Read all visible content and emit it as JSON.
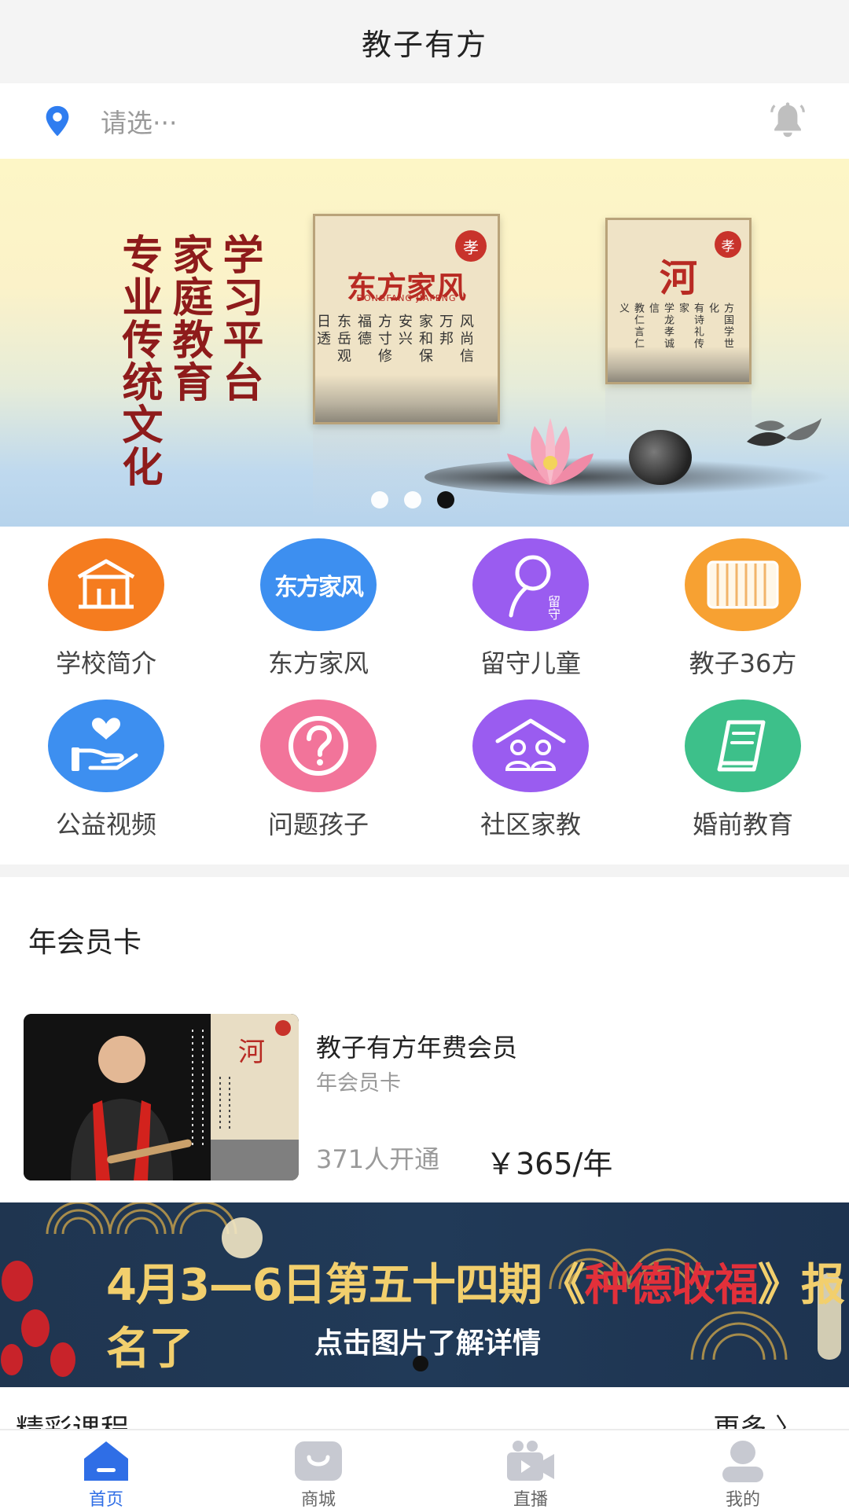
{
  "header": {
    "title": "教子有方"
  },
  "location": {
    "placeholder": "请选···"
  },
  "hero": {
    "slogan": [
      "学习平台",
      "家庭教育",
      "专业传统文化"
    ],
    "card1": {
      "badge": "孝",
      "title": "东方家风",
      "sub": "DONGFANG JIAFENG",
      "poem": [
        "风尚信万邦",
        "家和保安兴",
        "方寸修福德",
        "东岳观日透"
      ]
    },
    "card2": {
      "badge": "孝",
      "title": "河",
      "poem": [
        "方国学世化",
        "有诗礼传家",
        "学龙孝诚信",
        "教仁言仁义"
      ]
    },
    "slide_count": 3,
    "active_slide": 3
  },
  "grid": {
    "items": [
      {
        "label": "学校简介",
        "icon": "school-icon",
        "color": "#f57c1f"
      },
      {
        "label": "东方家风",
        "icon": "dongfang-logo-icon",
        "color": "#3d8ff0",
        "logo_text": "东方家风"
      },
      {
        "label": "留守儿童",
        "icon": "left-behind-child-icon",
        "color": "#9a5cf0",
        "small_text": "留守"
      },
      {
        "label": "教子36方",
        "icon": "bamboo-scroll-icon",
        "color": "#f7a132"
      },
      {
        "label": "公益视频",
        "icon": "charity-hand-icon",
        "color": "#3d8ff0"
      },
      {
        "label": "问题孩子",
        "icon": "question-icon",
        "color": "#f2749a"
      },
      {
        "label": "社区家教",
        "icon": "community-icon",
        "color": "#9a5cf0"
      },
      {
        "label": "婚前教育",
        "icon": "book-icon",
        "color": "#3dc08a"
      }
    ]
  },
  "membership": {
    "section_title": "年会员卡",
    "product": {
      "name": "教子有方年费会员",
      "tag": "年会员卡",
      "count": "371人开通",
      "price": "￥365/年"
    }
  },
  "event_banner": {
    "text_before": "4月3—6日第五十四期《",
    "highlight": "种德收福",
    "text_after": "》报名了",
    "sub": "点击图片了解详情"
  },
  "courses": {
    "title": "精彩课程",
    "more": "更多"
  },
  "tabbar": {
    "tabs": [
      {
        "label": "首页",
        "icon": "home-icon",
        "active": true
      },
      {
        "label": "商城",
        "icon": "shop-icon",
        "active": false
      },
      {
        "label": "直播",
        "icon": "live-camera-icon",
        "active": false
      },
      {
        "label": "我的",
        "icon": "profile-icon",
        "active": false
      }
    ]
  },
  "colors": {
    "accent": "#2f6ee6",
    "slogan_red": "#8e1b1b",
    "banner_gold": "#f2cf6d",
    "banner_red": "#e2303a"
  }
}
